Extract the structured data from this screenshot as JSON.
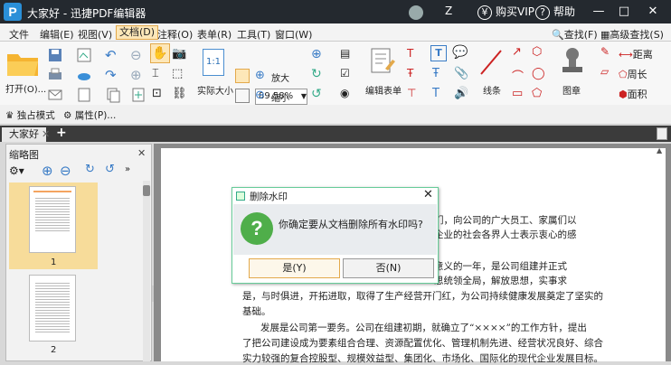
{
  "titlebar": {
    "title": "大家好 - 迅捷PDF编辑器",
    "user_name": "Z",
    "vip_label": "购买VIP",
    "vip_icon": "¥",
    "help_label": "帮助",
    "help_icon": "?",
    "minimize": "—",
    "maximize": "□",
    "close": "✕"
  },
  "menu": {
    "file": "文件",
    "edit": "编辑(E)",
    "view": "视图(V)",
    "document": "文档(D)",
    "comment": "注释(O)",
    "form": "表单(R)",
    "tools": "工具(T)",
    "window": "窗口(W)",
    "find": "查找(F)",
    "advanced_find": "高级查找(S)"
  },
  "ribbon": {
    "open": "打开(O)...",
    "zoom_value": "89.58%",
    "actual_size": "实际大小",
    "actual_size_glyph": "1:1",
    "zoom_in": "放大",
    "zoom_out": "缩小",
    "edit_form": "编辑表单",
    "line": "线条",
    "stamp": "图章",
    "distance": "距离",
    "perimeter": "周长",
    "area": "面积"
  },
  "subbar": {
    "exclusive_mode": "独占模式",
    "properties": "属性(P)..."
  },
  "tabs": {
    "doc_tab": "大家好",
    "close": "✕",
    "add": "+"
  },
  "thumbnails": {
    "title": "缩略图",
    "close": "✕",
    "pages": [
      "1",
      "2"
    ]
  },
  "document_lines": [
    "们，向公司的广大员工、家属们以",
    "企业的社会各界人士表示衷心的感",
    "意义的一年，是公司组建并正式",
    "思统领全局，解放思想，实事求",
    "是，与时俱进，开拓进取，取得了生产经营开门红，为公司持续健康发展奠定了坚实的",
    "基础。",
    "发展是公司第一要务。公司在组建初期，就确立了“××××”的工作方针，提出",
    "了把公司建设成为要素组合合理、资源配置优化、管理机制先进、经营状况良好、综合",
    "实力较强的复合控股型、规模效益型、集团化、市场化、国际化的现代企业发展目标。"
  ],
  "dialog": {
    "title": "删除水印",
    "close": "✕",
    "message": "你确定要从文档删除所有水印吗?",
    "icon": "?",
    "yes": "是(Y)",
    "no": "否(N)"
  },
  "colors": {
    "titlebar": "#24292f",
    "accent_orange": "#e3a94b",
    "dialog_icon": "#4fae4a",
    "logo_blue": "#2a8fd8"
  }
}
